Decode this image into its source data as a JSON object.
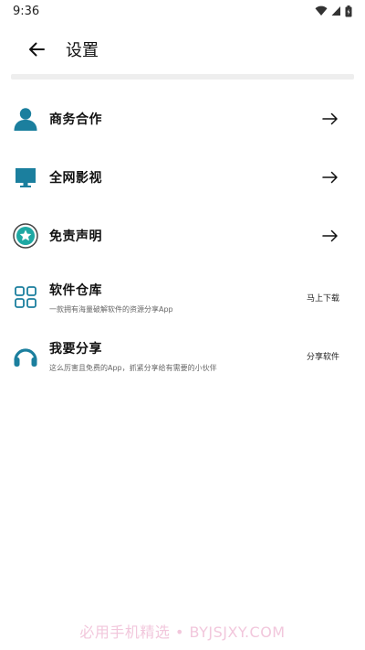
{
  "status": {
    "time": "9:36"
  },
  "header": {
    "title": "设置"
  },
  "items": [
    {
      "label": "商务合作",
      "icon": "user-icon",
      "right": "→"
    },
    {
      "label": "全网影视",
      "icon": "monitor-icon",
      "right": "→"
    },
    {
      "label": "免责声明",
      "icon": "star-badge-icon",
      "right": "→"
    },
    {
      "label": "软件仓库",
      "sub": "一款拥有海量破解软件的资源分享App",
      "icon": "grid-icon",
      "right": "马上下载"
    },
    {
      "label": "我要分享",
      "sub": "这么厉害且免费的App，抓紧分享给有需要的小伙伴",
      "icon": "headphones-icon",
      "right": "分享软件"
    }
  ],
  "watermark": "必用手机精选 • BYJSJXY.COM",
  "colors": {
    "accent": "#1b7f9e",
    "divider": "#eeeeee",
    "watermark": "#f2c7dc"
  }
}
